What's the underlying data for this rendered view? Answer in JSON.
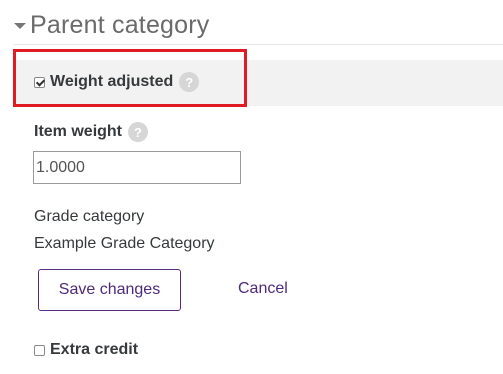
{
  "section": {
    "title": "Parent category"
  },
  "weight_adjusted": {
    "label": "Weight adjusted",
    "checked": true,
    "help": "?"
  },
  "item_weight": {
    "label": "Item weight",
    "help": "?",
    "value": "1.0000"
  },
  "grade_category": {
    "label": "Grade category",
    "value": "Example Grade Category"
  },
  "actions": {
    "save_label": "Save changes",
    "cancel_label": "Cancel"
  },
  "extra_credit": {
    "label": "Extra credit",
    "checked": false
  },
  "colors": {
    "accent": "#4e2a79",
    "highlight": "#e01b24"
  }
}
